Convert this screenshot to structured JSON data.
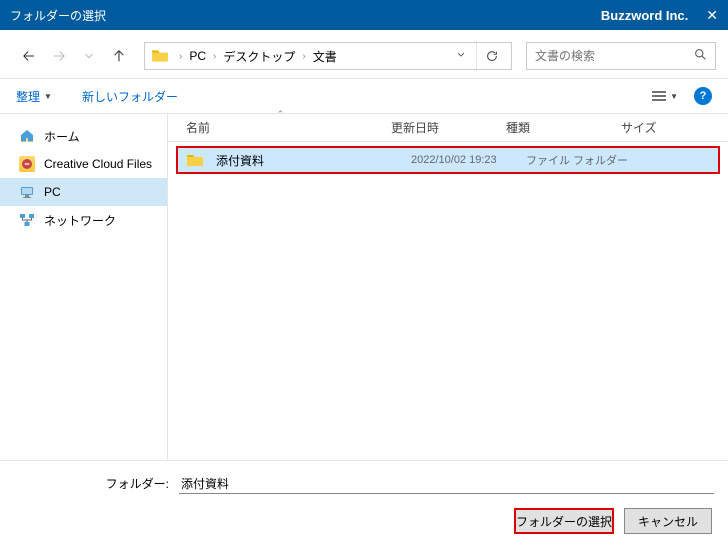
{
  "title_bar": {
    "title": "フォルダーの選択",
    "company": "Buzzword Inc."
  },
  "breadcrumb": {
    "segments": [
      "PC",
      "デスクトップ",
      "文書"
    ]
  },
  "search": {
    "placeholder": "文書の検索"
  },
  "commands": {
    "organize": "整理",
    "new_folder": "新しいフォルダー"
  },
  "sidebar": {
    "items": [
      {
        "label": "ホーム",
        "icon": "home"
      },
      {
        "label": "Creative Cloud Files",
        "icon": "cloud"
      },
      {
        "label": "PC",
        "icon": "pc",
        "selected": true
      },
      {
        "label": "ネットワーク",
        "icon": "network"
      }
    ]
  },
  "columns": {
    "name": "名前",
    "date": "更新日時",
    "type": "種類",
    "size": "サイズ"
  },
  "rows": [
    {
      "name": "添付資料",
      "date": "2022/10/02 19:23",
      "type": "ファイル フォルダー",
      "size": ""
    }
  ],
  "footer": {
    "label": "フォルダー:",
    "value": "添付資料",
    "select_btn": "フォルダーの選択",
    "cancel_btn": "キャンセル"
  }
}
